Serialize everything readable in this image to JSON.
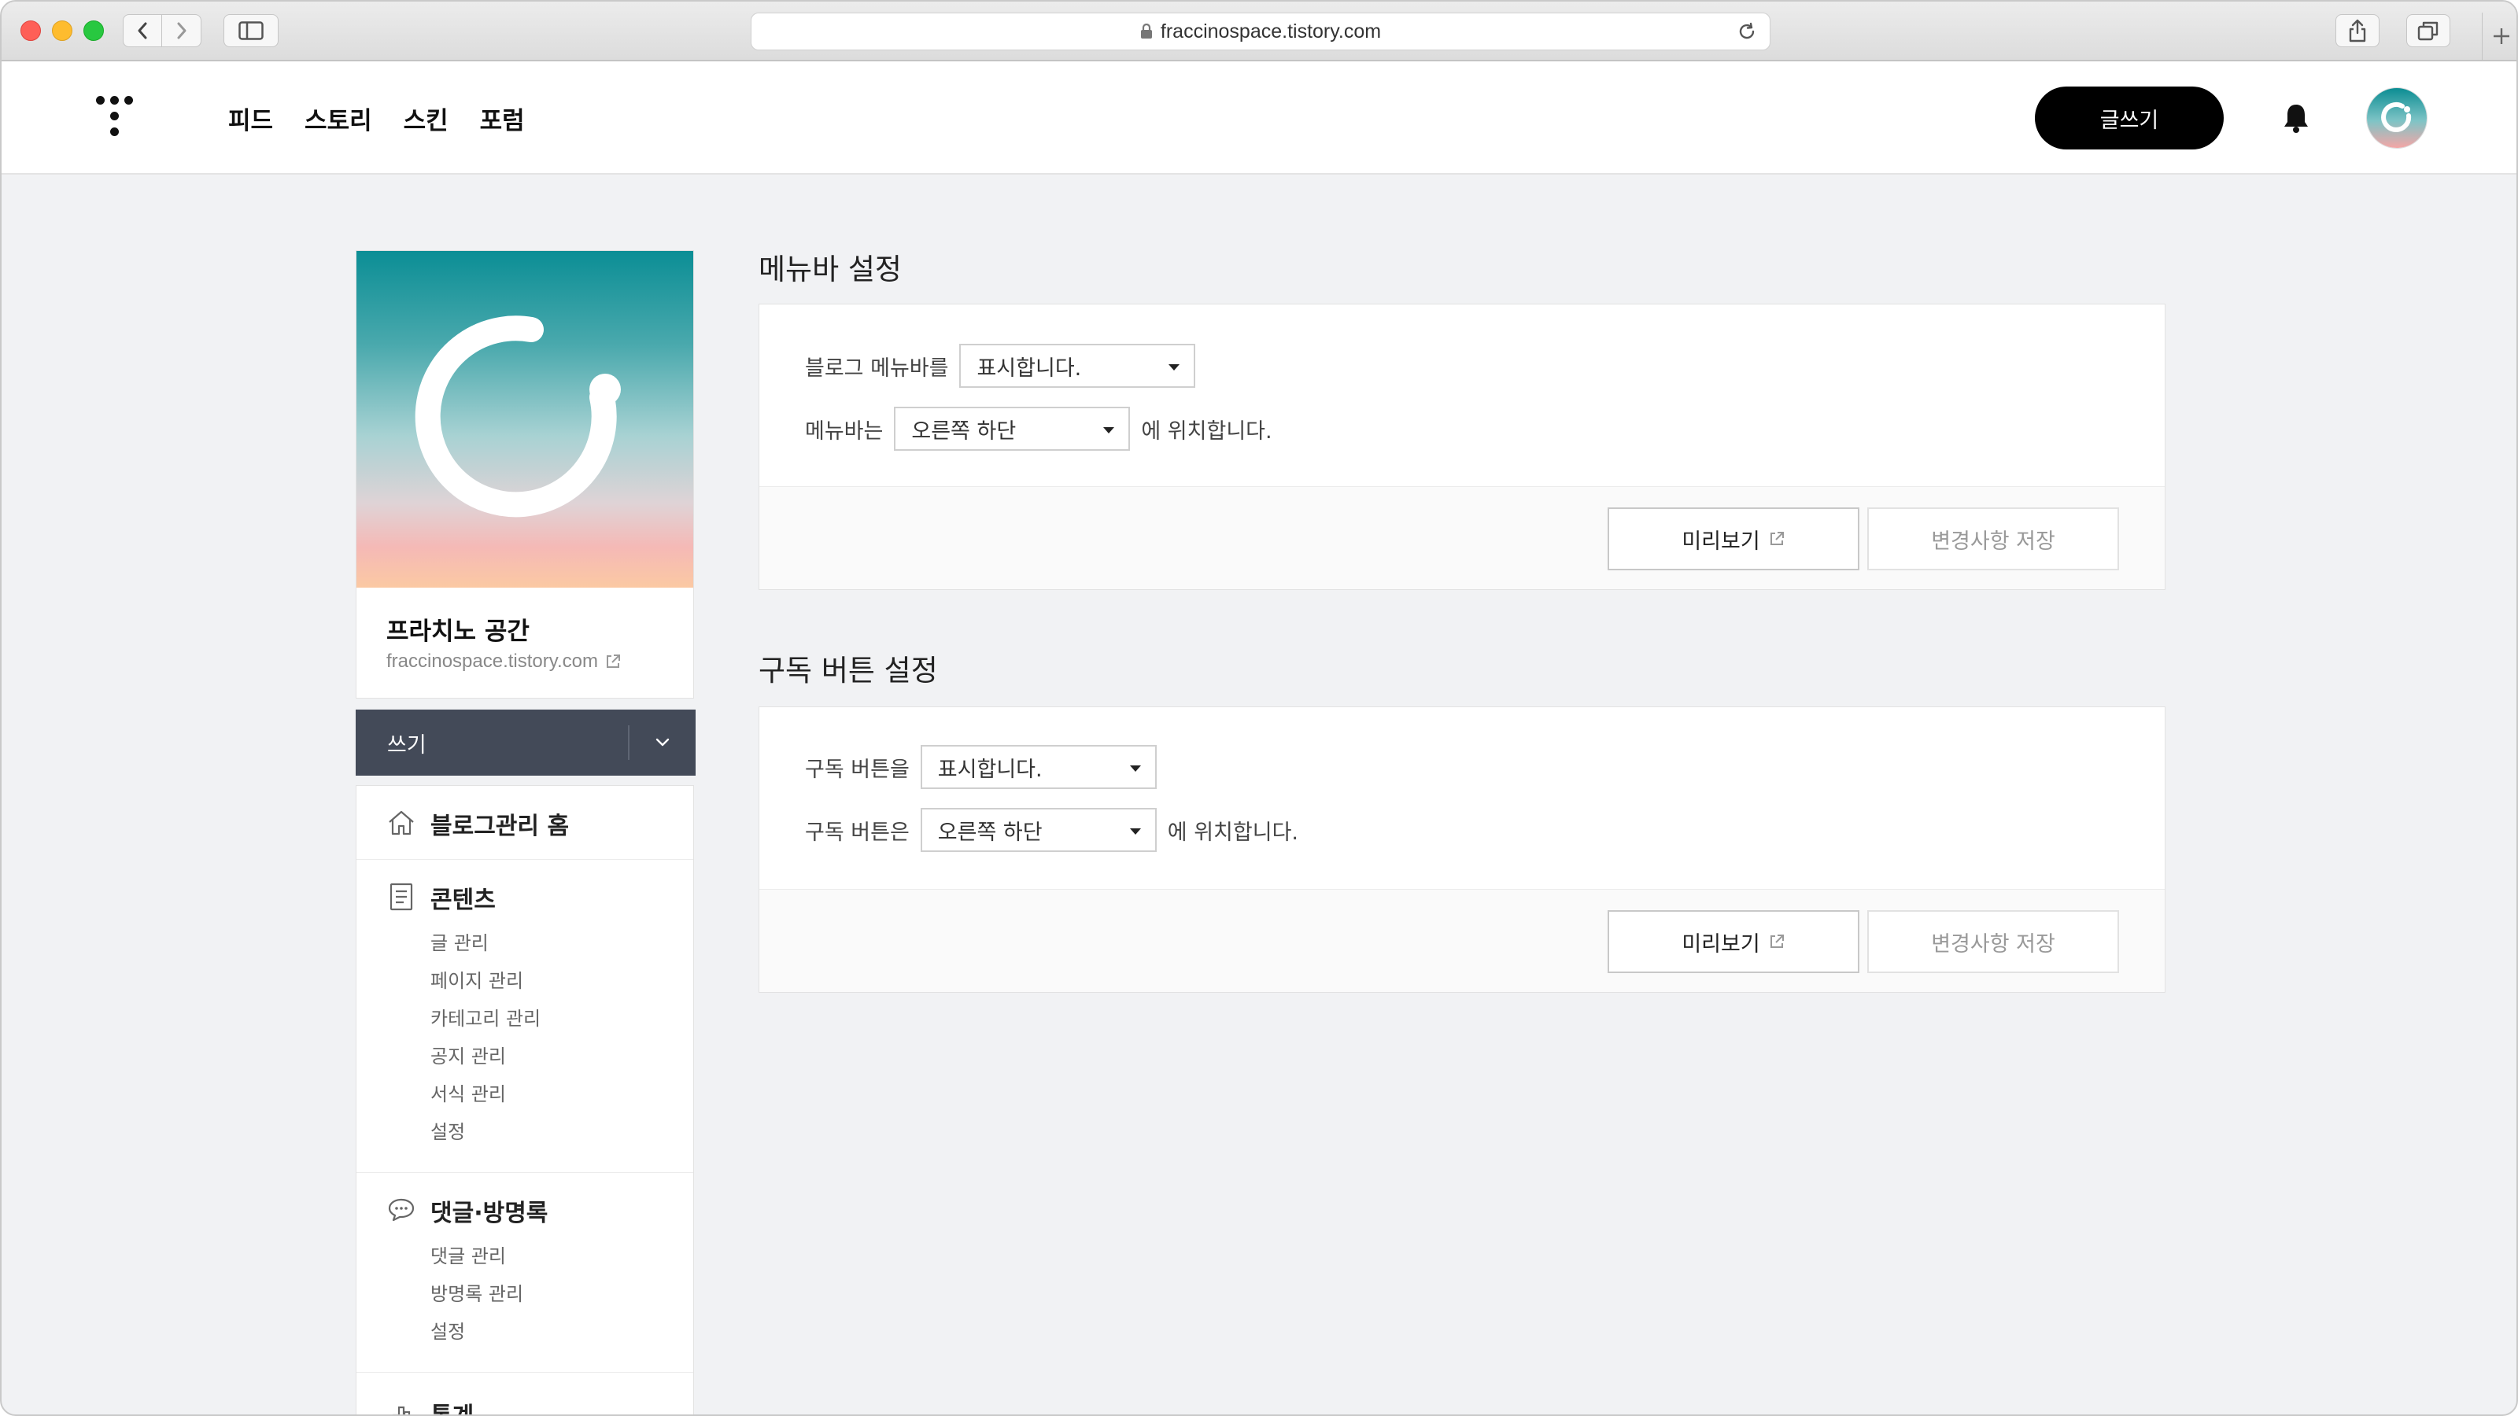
{
  "browser": {
    "url": "fraccinospace.tistory.com"
  },
  "header": {
    "nav": [
      "피드",
      "스토리",
      "스킨",
      "포럼"
    ],
    "write_button": "글쓰기"
  },
  "sidebar": {
    "blog_name": "프라치노 공간",
    "blog_url": "fraccinospace.tistory.com",
    "write_menu": "쓰기",
    "home": "블로그관리 홈",
    "content": {
      "title": "콘텐츠",
      "items": [
        "글 관리",
        "페이지 관리",
        "카테고리 관리",
        "공지 관리",
        "서식 관리",
        "설정"
      ]
    },
    "comments": {
      "title": "댓글·방명록",
      "items": [
        "댓글 관리",
        "방명록 관리",
        "설정"
      ]
    },
    "stats": {
      "title": "통계"
    }
  },
  "menubar_settings": {
    "title": "메뉴바 설정",
    "row1_label": "블로그 메뉴바를",
    "row1_value": "표시합니다.",
    "row2_label": "메뉴바는",
    "row2_value": "오른쪽 하단",
    "row2_suffix": "에 위치합니다.",
    "preview": "미리보기",
    "save": "변경사항 저장"
  },
  "subscribe_settings": {
    "title": "구독 버튼 설정",
    "row1_label": "구독 버튼을",
    "row1_value": "표시합니다.",
    "row2_label": "구독 버튼은",
    "row2_value": "오른쪽 하단",
    "row2_suffix": "에 위치합니다.",
    "preview": "미리보기",
    "save": "변경사항 저장"
  },
  "colors": {
    "accent_dark": "#434a58",
    "write_button_bg": "#000000",
    "page_bg": "#f1f2f4"
  }
}
